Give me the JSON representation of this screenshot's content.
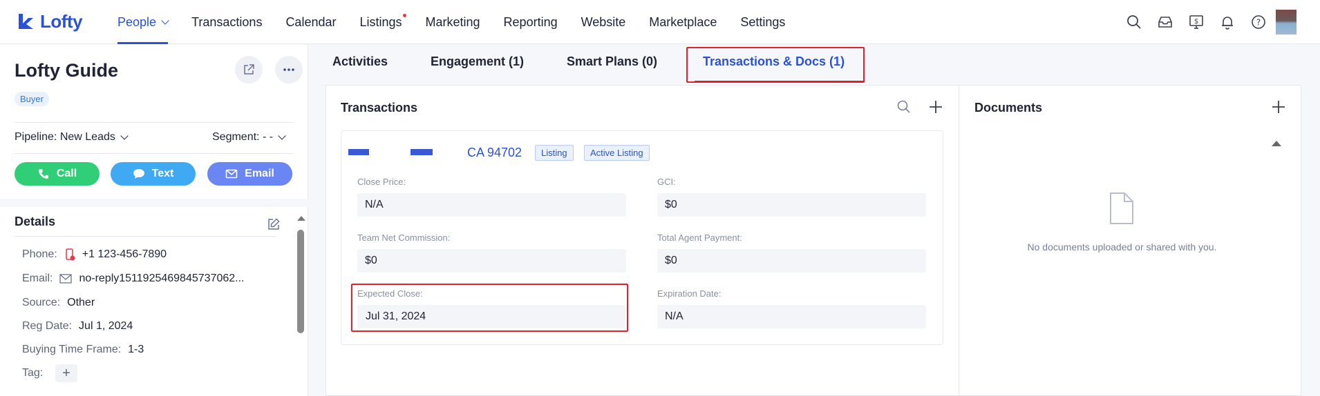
{
  "app": {
    "logo_text": "Lofty",
    "brand_color": "#2a52d8"
  },
  "nav": {
    "items": [
      {
        "label": "People",
        "active": true,
        "dropdown": true
      },
      {
        "label": "Transactions"
      },
      {
        "label": "Calendar"
      },
      {
        "label": "Listings",
        "notification_dot": true
      },
      {
        "label": "Marketing"
      },
      {
        "label": "Reporting"
      },
      {
        "label": "Website"
      },
      {
        "label": "Marketplace"
      },
      {
        "label": "Settings"
      }
    ],
    "icons": [
      "search-icon",
      "inbox-icon",
      "dollar-screen-icon",
      "bell-icon",
      "help-icon"
    ]
  },
  "contact": {
    "name": "Lofty Guide",
    "type_tag": "Buyer",
    "pipeline_label": "Pipeline:",
    "pipeline_value": "New Leads",
    "segment_label": "Segment:",
    "segment_value": "- -",
    "actions": {
      "call": "Call",
      "text": "Text",
      "email": "Email"
    }
  },
  "details": {
    "title": "Details",
    "phone_label": "Phone:",
    "phone": "+1 123-456-7890",
    "email_label": "Email:",
    "email": "no-reply1511925469845737062...",
    "source_label": "Source:",
    "source": "Other",
    "reg_date_label": "Reg Date:",
    "reg_date": "Jul 1, 2024",
    "buying_time_label": "Buying Time Frame:",
    "buying_time": "1-3",
    "tag_label": "Tag:"
  },
  "tabs": [
    {
      "label": "Activities"
    },
    {
      "label": "Engagement (1)"
    },
    {
      "label": "Smart Plans (0)"
    },
    {
      "label": "Transactions & Docs (1)",
      "active": true
    }
  ],
  "transactions": {
    "title": "Transactions",
    "item": {
      "address": "CA 94702",
      "chip_type": "Listing",
      "chip_status": "Active Listing",
      "close_price_label": "Close Price:",
      "close_price": "N/A",
      "gci_label": "GCI:",
      "gci": "$0",
      "team_net_label": "Team Net Commission:",
      "team_net": "$0",
      "total_agent_label": "Total Agent Payment:",
      "total_agent": "$0",
      "expected_close_label": "Expected Close:",
      "expected_close": "Jul 31, 2024",
      "expiration_label": "Expiration Date:",
      "expiration": "N/A"
    }
  },
  "documents": {
    "title": "Documents",
    "empty_text": "No documents uploaded or shared with you."
  },
  "colors": {
    "call": "#2fce77",
    "text": "#40a9f3",
    "email": "#6a86f2",
    "highlight": "#e0222f"
  }
}
